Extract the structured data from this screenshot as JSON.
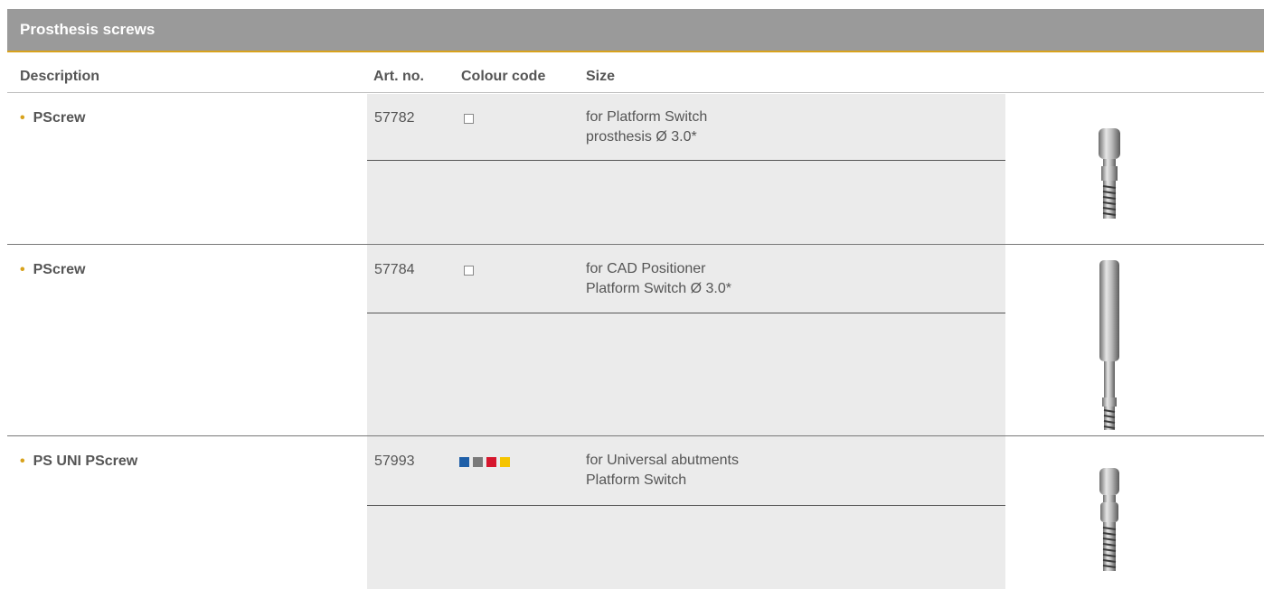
{
  "title": "Prosthesis screws",
  "columns": {
    "description": "Description",
    "art_no": "Art. no.",
    "colour_code": "Colour code",
    "size": "Size"
  },
  "rows": [
    {
      "description": "PScrew",
      "art_no": "57782",
      "colour_code": "empty",
      "size_line1": "for Platform Switch",
      "size_line2": "prosthesis Ø 3.0*",
      "image_icon": "short-screw-icon"
    },
    {
      "description": "PScrew",
      "art_no": "57784",
      "colour_code": "empty",
      "size_line1": "for CAD Positioner",
      "size_line2": "Platform Switch Ø 3.0*",
      "image_icon": "long-screw-icon"
    },
    {
      "description": "PS UNI PScrew",
      "art_no": "57993",
      "colour_code": [
        "#1f5fa8",
        "#7a7a7a",
        "#d6162d",
        "#f5c400"
      ],
      "size_line1": "for Universal abutments",
      "size_line2": "Platform Switch",
      "image_icon": "uni-screw-icon"
    }
  ],
  "colors": {
    "title_bar": "#9a9a9a",
    "accent": "#d8a21c",
    "panel": "#ebebeb"
  }
}
